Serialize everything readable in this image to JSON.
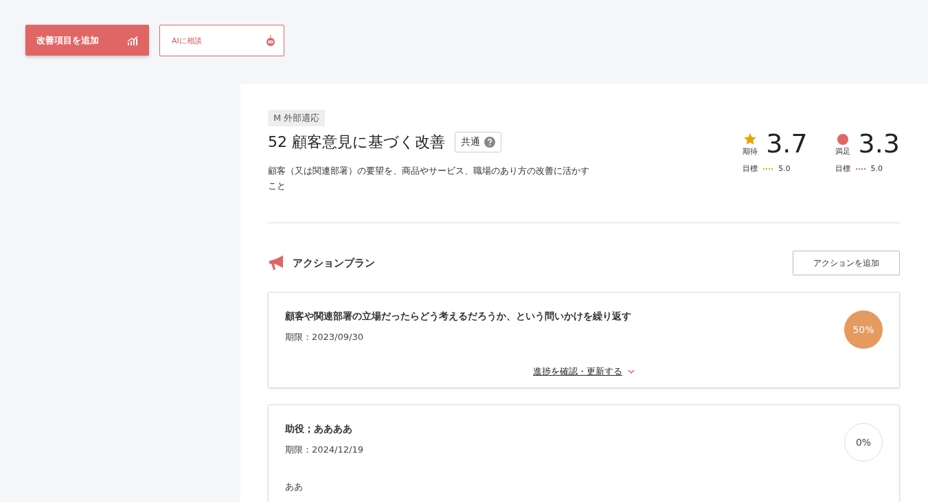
{
  "toolbar": {
    "add_button": "改善項目を追加",
    "ai_button": "AIに相談"
  },
  "item": {
    "category": "M 外部適応",
    "title": "52 顧客意見に基づく改善",
    "scope": "共通",
    "description": "顧客（又は関連部署）の要望を、商品やサービス、職場のあり方の改善に活かすこと",
    "scores": [
      {
        "kind": "star",
        "color": "#e8a600",
        "label": "期待",
        "value": "3.7",
        "target_label": "目標",
        "target": "5.0"
      },
      {
        "kind": "dot",
        "color": "#e06666",
        "label": "満足",
        "value": "3.3",
        "target_label": "目標",
        "target": "5.0"
      }
    ]
  },
  "action_plan": {
    "title": "アクションプラン",
    "add_button": "アクションを追加",
    "actions": [
      {
        "title": "顧客や関連部署の立場だったらどう考えるだろうか、という問いかけを繰り返す",
        "deadline": "期限：2023/09/30",
        "progress": "50%",
        "kind": "started",
        "link": "進捗を確認・更新する"
      },
      {
        "title": "助役；ああああ",
        "deadline": "期限：2024/12/19",
        "progress": "0%",
        "kind": "not_started",
        "note": "ああ"
      }
    ]
  }
}
